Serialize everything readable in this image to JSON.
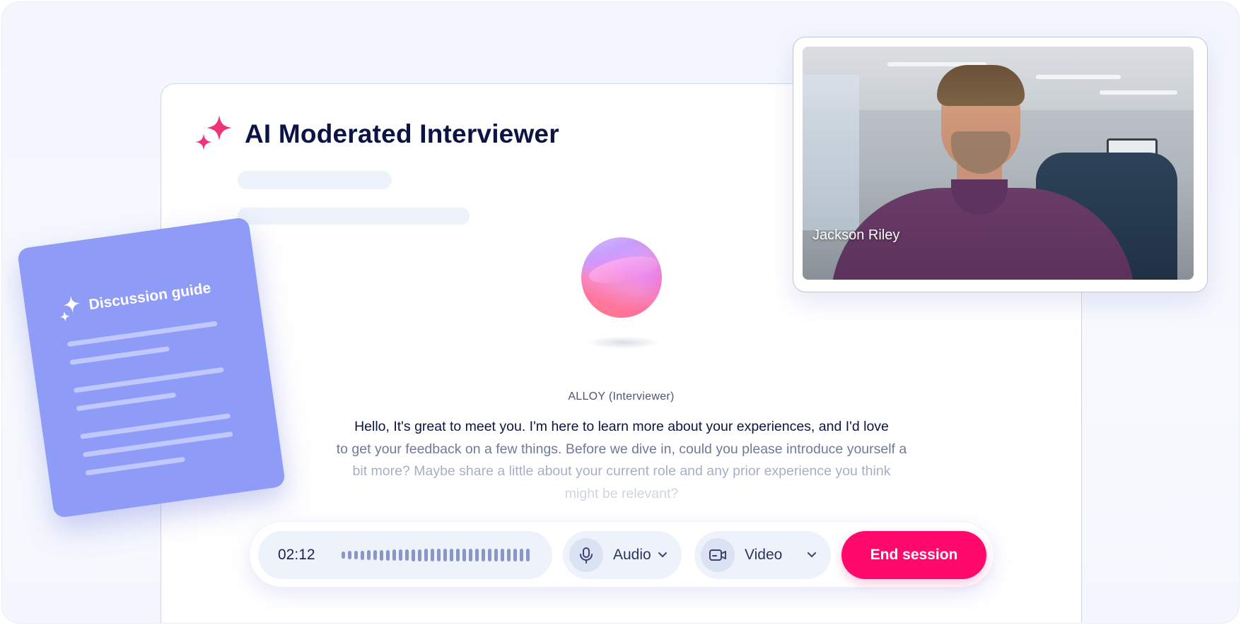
{
  "app": {
    "title": "AI Moderated Interviewer"
  },
  "interviewer": {
    "speaker_label": "ALLOY (Interviewer)",
    "transcript_lines": [
      "Hello, It's great to meet you. I'm here to learn more about your experiences, and I'd love",
      "to get your feedback on a few things. Before we dive in, could you please introduce yourself a",
      "bit more? Maybe share a little about your current role and any prior experience you think",
      "might be relevant?"
    ]
  },
  "participant": {
    "name": "Jackson Riley"
  },
  "discussion_guide": {
    "title": "Discussion guide"
  },
  "controls": {
    "timer": "02:12",
    "audio_label": "Audio",
    "video_label": "Video",
    "end_label": "End session"
  },
  "icons": {
    "title": "sparkle-icon",
    "guide": "sparkle-icon",
    "audio": "microphone-icon",
    "video": "camera-icon",
    "dropdown": "chevron-down-icon"
  },
  "colors": {
    "accent": "#ff0a6c",
    "sparkle": "#f0347c",
    "guide_card": "#8f9cf7",
    "title_text": "#0b1445"
  }
}
